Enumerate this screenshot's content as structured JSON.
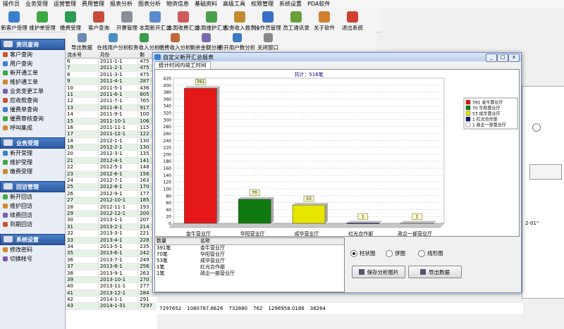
{
  "menu": [
    "操作员",
    "业务受理",
    "运营管理",
    "费用管理",
    "报表分析",
    "图表分析",
    "物资信息",
    "基础资料",
    "高级工具",
    "权限管理",
    "系统设置",
    "PDA软件"
  ],
  "toolbar": [
    {
      "label": "新客户受理",
      "color": "#3a7ed0"
    },
    {
      "label": "维护单受理",
      "color": "#3fa845"
    },
    {
      "label": "缴费受理",
      "color": "#2f9a52"
    },
    {
      "label": "客户查询",
      "color": "#c94a3a"
    },
    {
      "label": "开票管理",
      "color": "#888f9a"
    },
    {
      "label": "本周新开汇总",
      "color": "#5a8ad0"
    },
    {
      "label": "本周收费汇总",
      "color": "#d05a5a"
    },
    {
      "label": "本周维护汇总",
      "color": "#4aa04a"
    },
    {
      "label": "权责收入报表",
      "color": "#c08a30"
    },
    {
      "label": "操作员管理",
      "color": "#3a70c8"
    },
    {
      "label": "员工通讯录",
      "color": "#6aa03a"
    },
    {
      "label": "关于软件",
      "color": "#d08030"
    },
    {
      "label": "退出系统",
      "color": "#d04030"
    }
  ],
  "toolbar2": [
    {
      "label": "导出数据",
      "color": "#6a8ab0"
    },
    {
      "label": "在线用户分析",
      "color": "#4a90c0"
    },
    {
      "label": "权责收入分析",
      "color": "#3a9a4a"
    },
    {
      "label": "缴费收入分析",
      "color": "#c06a3a"
    },
    {
      "label": "剩余金额分析",
      "color": "#7a6ab0"
    },
    {
      "label": "新开用户数分析",
      "color": "#3a7ac0"
    },
    {
      "label": "关闭窗口",
      "color": "#888"
    }
  ],
  "sidebar": [
    {
      "title": "资讯查询",
      "items": [
        "客户查询",
        "用户查询",
        "新开通工单",
        "维护通工单",
        "业务变更工单",
        "应收款查询",
        "催费单查询",
        "催费审核查询",
        "呼叫集成"
      ]
    },
    {
      "title": "业务受理",
      "items": [
        "新开受理",
        "维护受理",
        "缴费受理"
      ]
    },
    {
      "title": "回访管理",
      "items": [
        "新开回访",
        "维护回访",
        "续费回访",
        "到期回访"
      ]
    },
    {
      "title": "系统设置",
      "items": [
        "修改密码",
        "切换帐号"
      ]
    }
  ],
  "grid": {
    "headers": [
      "流水号",
      "月份",
      "剩"
    ],
    "rows": [
      [
        "6",
        "2011-1-1",
        "475"
      ],
      [
        "7",
        "2011-2-1",
        "475"
      ],
      [
        "8",
        "2011-3-1",
        "475"
      ],
      [
        "9",
        "2011-4-1",
        "287"
      ],
      [
        "10",
        "2011-5-1",
        "436"
      ],
      [
        "11",
        "2011-6-1",
        "605"
      ],
      [
        "12",
        "2011-7-1",
        "765"
      ],
      [
        "13",
        "2011-8-1",
        "917"
      ],
      [
        "14",
        "2011-9-1",
        "100"
      ],
      [
        "15",
        "2011-10-1",
        "106"
      ],
      [
        "16",
        "2011-11-1",
        "115"
      ],
      [
        "17",
        "2011-12-1",
        "122"
      ],
      [
        "18",
        "2012-1-1",
        "130"
      ],
      [
        "19",
        "2012-2-1",
        "130"
      ],
      [
        "20",
        "2012-3-1",
        "135"
      ],
      [
        "21",
        "2012-4-1",
        "141"
      ],
      [
        "22",
        "2012-5-1",
        "148"
      ],
      [
        "23",
        "2012-6-1",
        "156"
      ],
      [
        "24",
        "2012-7-1",
        "163"
      ],
      [
        "25",
        "2012-8-1",
        "170"
      ],
      [
        "26",
        "2012-9-1",
        "177"
      ],
      [
        "27",
        "2012-10-1",
        "185"
      ],
      [
        "28",
        "2012-11-1",
        "193"
      ],
      [
        "29",
        "2012-12-1",
        "200"
      ],
      [
        "30",
        "2013-1-1",
        "207"
      ],
      [
        "31",
        "2013-2-1",
        "214"
      ],
      [
        "32",
        "2013-3-1",
        "221"
      ],
      [
        "33",
        "2013-4-1",
        "228"
      ],
      [
        "34",
        "2013-5-1",
        "235"
      ],
      [
        "35",
        "2013-6-1",
        "242"
      ],
      [
        "36",
        "2013-7-1",
        "249"
      ],
      [
        "37",
        "2013-8-1",
        "256"
      ],
      [
        "38",
        "2013-9-1",
        "263"
      ],
      [
        "39",
        "2013-10-1",
        "270"
      ],
      [
        "40",
        "2013-11-1",
        "277"
      ],
      [
        "41",
        "2013-12-1",
        "284"
      ],
      [
        "42",
        "2014-1-1",
        "291"
      ],
      [
        "43",
        "2014-1-31",
        "7297"
      ]
    ]
  },
  "bottom_strip": [
    "7297652",
    "1080787.8626",
    "732880",
    "762",
    "1298958.0166",
    "38264"
  ],
  "bg_value": "2-01\"",
  "dialog": {
    "title": "自定义新开汇总报表",
    "tabs": [
      "统计时间内竣工时间"
    ],
    "win_buttons": [
      "_",
      "□",
      "x"
    ]
  },
  "chart_data": {
    "type": "bar",
    "title": "共计：516笔",
    "categories": [
      "金牛营业厅",
      "华阳营业厅",
      "成华营业厅",
      "红光合作部",
      "政企一部营业厅"
    ],
    "values": [
      391,
      70,
      53,
      1,
      1
    ],
    "colors": [
      "#e41818",
      "#0f7a0f",
      "#e6e600",
      "#101080",
      "#ffffff"
    ],
    "ylim": [
      0,
      420
    ],
    "yticks": [
      0,
      20,
      40,
      60,
      80,
      100,
      120,
      140,
      160,
      180,
      200,
      220,
      240,
      260,
      280,
      300,
      320,
      340,
      360,
      380,
      400,
      420
    ],
    "legend": [
      "391 金牛营业厅",
      "70 华阳营业厅",
      "53 成华营业厅",
      "1 红光合作部",
      "1 政企一部营业厅"
    ],
    "legend_position": "right",
    "grid": true
  },
  "list": {
    "headers": [
      "数量",
      "名称"
    ],
    "rows": [
      [
        "391笔",
        "金牛营业厅"
      ],
      [
        "70笔",
        "华阳营业厅"
      ],
      [
        "53笔",
        "成华营业厅"
      ],
      [
        "1笔",
        "红光合作部"
      ],
      [
        "1笔",
        "政企一部营业厅"
      ]
    ]
  },
  "options": [
    {
      "label": "柱状图",
      "checked": true
    },
    {
      "label": "饼图",
      "checked": false
    },
    {
      "label": "线形图",
      "checked": false
    }
  ],
  "buttons": {
    "save": "保存分析图片",
    "export": "导出数据"
  }
}
